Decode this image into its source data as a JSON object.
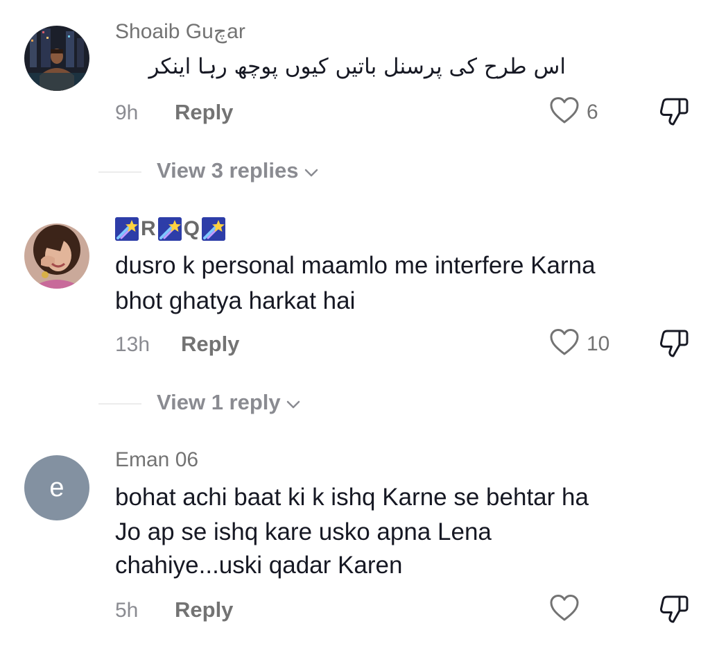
{
  "comments": [
    {
      "username": "Shoaib Guچar",
      "text_lines": [
        "اس طرح کی پرسنل باتیں کیوں پوچھ رہا اینکر"
      ],
      "time": "9h",
      "reply_label": "Reply",
      "likes": "6",
      "view_replies": "View 3 replies"
    },
    {
      "username_letters": [
        "R",
        "Q"
      ],
      "text_lines": [
        "dusro k personal maamlo me interfere Karna",
        "bhot ghatya harkat hai"
      ],
      "time": "13h",
      "reply_label": "Reply",
      "likes": "10",
      "view_replies": "View 1 reply"
    },
    {
      "username": "Eman 06",
      "avatar_initial": "e",
      "text_lines": [
        "bohat achi baat ki k ishq Karne se behtar ha",
        "Jo ap se ishq kare usko apna Lena",
        "chahiye...uski qadar Karen"
      ],
      "time": "5h",
      "reply_label": "Reply",
      "likes": ""
    }
  ],
  "icons": {
    "like": "heart-outline-icon",
    "dislike": "thumbs-down-outline-icon",
    "expand": "chevron-down-icon",
    "badge": "shooting-star-emoji"
  },
  "colors": {
    "username": "#737373",
    "text": "#161823",
    "secondary": "#8a8b91",
    "initial_avatar_bg": "#8391a1"
  }
}
